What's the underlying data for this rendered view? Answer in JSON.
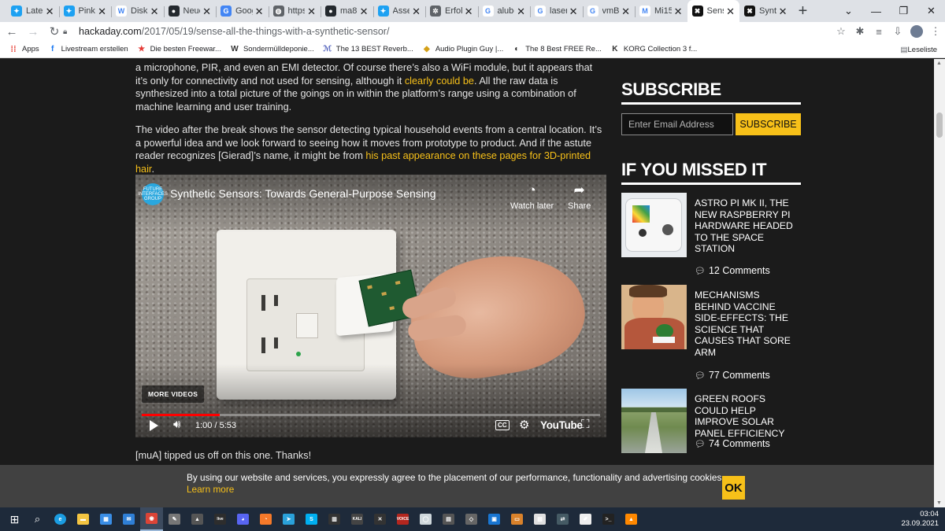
{
  "tabs": [
    {
      "title": "Latest",
      "icon": "twitter-icon",
      "color": "#1da1f2",
      "glyph": "✦"
    },
    {
      "title": "Pinkly",
      "icon": "twitter-icon",
      "color": "#1da1f2",
      "glyph": "✦"
    },
    {
      "title": "Diskussion",
      "icon": "wikipedia-icon",
      "color": "#ffffff",
      "glyph": "W"
    },
    {
      "title": "Neue",
      "icon": "github-icon",
      "color": "#24292e",
      "glyph": "●"
    },
    {
      "title": "Google",
      "icon": "google-translate-icon",
      "color": "#4285f4",
      "glyph": "G"
    },
    {
      "title": "https",
      "icon": "globe-icon",
      "color": "#5f6368",
      "glyph": "◍"
    },
    {
      "title": "ma8",
      "icon": "github-icon",
      "color": "#24292e",
      "glyph": "●"
    },
    {
      "title": "Assets",
      "icon": "twitter-icon",
      "color": "#1da1f2",
      "glyph": "✦"
    },
    {
      "title": "Erfolg",
      "icon": "gear-icon",
      "color": "#5f6368",
      "glyph": "✲"
    },
    {
      "title": "alubox",
      "icon": "google-icon",
      "color": "#ffffff",
      "glyph": "G"
    },
    {
      "title": "laser",
      "icon": "google-icon",
      "color": "#ffffff",
      "glyph": "G"
    },
    {
      "title": "vmB",
      "icon": "google-icon",
      "color": "#ffffff",
      "glyph": "G"
    },
    {
      "title": "Mi15",
      "icon": "m-icon",
      "color": "#ffffff",
      "glyph": "M"
    },
    {
      "title": "Sense",
      "icon": "hackaday-icon",
      "color": "#111111",
      "glyph": "✖",
      "active": true
    },
    {
      "title": "Synth",
      "icon": "hackaday-icon",
      "color": "#111111",
      "glyph": "✖"
    }
  ],
  "url": {
    "host": "hackaday.com",
    "path": "/2017/05/19/sense-all-the-things-with-a-synthetic-sensor/"
  },
  "bookmarks": {
    "apps": "Apps",
    "items": [
      {
        "label": "Livestream erstellen",
        "icon": "facebook-icon",
        "color": "#1877f2",
        "glyph": "f"
      },
      {
        "label": "Die besten Freewar...",
        "icon": "star-icon",
        "color": "#e53935",
        "glyph": "★"
      },
      {
        "label": "Sondermülldeponie...",
        "icon": "wikipedia-icon",
        "color": "#333333",
        "glyph": "W"
      },
      {
        "label": "The 13 BEST Reverb...",
        "icon": "music-icon",
        "color": "#5c6bc0",
        "glyph": "ℳ"
      },
      {
        "label": "Audio Plugin Guy |...",
        "icon": "audio-plugin-icon",
        "color": "#d4a017",
        "glyph": "◆"
      },
      {
        "label": "The 8 Best FREE Re...",
        "icon": "moon-icon",
        "color": "#222222",
        "glyph": "◐"
      },
      {
        "label": "KORG Collection 3 f...",
        "icon": "korg-icon",
        "color": "#333333",
        "glyph": "K"
      }
    ],
    "reading_list": "Leseliste"
  },
  "article": {
    "p1_before": "a microphone, PIR, and even an EMI detector. Of course there’s also a WiFi module, but it appears that it’s only for connectivity and not used for sensing, although it ",
    "p1_link": "clearly could be",
    "p1_after": ". All the raw data is synthesized into a total picture of the goings on in within the platform’s range using a combination of machine learning and user training.",
    "p2_before": "The video after the break shows the sensor detecting typical household events from a central location. It’s a powerful idea and we look forward to seeing how it moves from prototype to product. And if the astute reader recognizes [Gierad]’s name, it might be from ",
    "p2_link": "his past appearance on these pages for 3D-printed hair",
    "p2_after": ".",
    "p4": "[muA] tipped us off on this one. Thanks!"
  },
  "video": {
    "title": "Synthetic Sensors: Towards General-Purpose Sensing",
    "channel_logo": "FUTURE INTERFACES GROUP",
    "watch_later": "Watch later",
    "share": "Share",
    "more_videos": "MORE VIDEOS",
    "time": "1:00 / 5:53",
    "progress": 0.17,
    "cc": "CC",
    "brand": "YouTube"
  },
  "sidebar": {
    "subscribe_heading": "SUBSCRIBE",
    "email_placeholder": "Enter Email Address",
    "subscribe_button": "SUBSCRIBE",
    "missed_heading": "IF YOU MISSED IT",
    "posts": [
      {
        "title": "ASTRO PI MK II, THE NEW RASPBERRY PI HARDWARE HEADED TO THE SPACE STATION",
        "comments": "12 Comments"
      },
      {
        "title": "MECHANISMS BEHIND VACCINE SIDE-EFFECTS: THE SCIENCE THAT CAUSES THAT SORE ARM",
        "comments": "77 Comments"
      },
      {
        "title": "GREEN ROOFS COULD HELP IMPROVE SOLAR PANEL EFFICIENCY",
        "comments": "74 Comments"
      }
    ]
  },
  "cookie": {
    "message": "By using our website and services, you expressly agree to the placement of our performance, functionality and advertising cookies.",
    "learn_more": "Learn more",
    "ok": "OK"
  },
  "taskbar": {
    "apps": [
      {
        "name": "file-explorer-icon",
        "color": "#f4c542",
        "glyph": "▬"
      },
      {
        "name": "store-icon",
        "color": "#3a8ee6",
        "glyph": "▦"
      },
      {
        "name": "mail-icon",
        "color": "#2f7fd6",
        "glyph": "✉"
      },
      {
        "name": "chrome-icon",
        "color": "#db4437",
        "glyph": "◉",
        "active": true
      },
      {
        "name": "pen-tablet-icon",
        "color": "#777777",
        "glyph": "✎"
      },
      {
        "name": "inkscape-icon",
        "color": "#555555",
        "glyph": "▲"
      },
      {
        "name": "live-icon",
        "color": "#2d2d2d",
        "glyph": "live"
      },
      {
        "name": "discord-icon",
        "color": "#5865f2",
        "glyph": "◕"
      },
      {
        "name": "blender-icon",
        "color": "#f5792a",
        "glyph": "◔"
      },
      {
        "name": "telegram-icon",
        "color": "#2aa1da",
        "glyph": "➤"
      },
      {
        "name": "skype-icon",
        "color": "#00aff0",
        "glyph": "S"
      },
      {
        "name": "calculator-icon",
        "color": "#333333",
        "glyph": "▥"
      },
      {
        "name": "kali-icon",
        "color": "#444444",
        "glyph": "KALI"
      },
      {
        "name": "cross-tool-icon",
        "color": "#333333",
        "glyph": "✕"
      },
      {
        "name": "voicemeeter-icon",
        "color": "#b3261e",
        "glyph": "VOICE"
      },
      {
        "name": "chat-icon",
        "color": "#cfd8dc",
        "glyph": "◯"
      },
      {
        "name": "terminal-icon",
        "color": "#555555",
        "glyph": "▤"
      },
      {
        "name": "cube-icon",
        "color": "#666666",
        "glyph": "◇"
      },
      {
        "name": "window-app-icon",
        "color": "#1976d2",
        "glyph": "▣"
      },
      {
        "name": "active-app-icon",
        "color": "#d9822b",
        "glyph": "▭"
      },
      {
        "name": "notes-icon",
        "color": "#e0e0e0",
        "glyph": "▧"
      },
      {
        "name": "sync-icon",
        "color": "#455a64",
        "glyph": "⇄"
      },
      {
        "name": "editor-icon",
        "color": "#eeeeee",
        "glyph": "✐"
      },
      {
        "name": "console-icon",
        "color": "#222222",
        "glyph": ">_"
      },
      {
        "name": "vlc-icon",
        "color": "#ff8800",
        "glyph": "▲"
      }
    ],
    "time": "03:04",
    "date": "23.09.2021"
  }
}
